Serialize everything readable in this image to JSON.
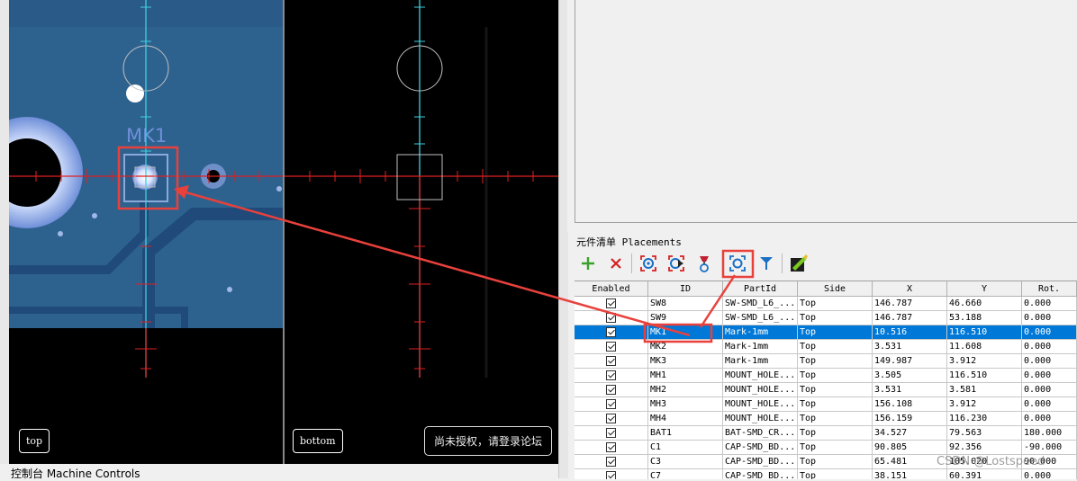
{
  "camera_views": {
    "top": {
      "label": "top",
      "overlay_text": "MK1"
    },
    "bottom": {
      "label": "bottom",
      "notice": "尚未授权，请登录论坛"
    }
  },
  "console": {
    "label": "控制台 Machine Controls"
  },
  "placements": {
    "title": "元件清单 Placements",
    "toolbar": [
      {
        "name": "add-icon",
        "tooltip": ""
      },
      {
        "name": "delete-icon",
        "tooltip": ""
      },
      {
        "name": "camera-target-icon",
        "tooltip": ""
      },
      {
        "name": "camera-move-icon",
        "tooltip": ""
      },
      {
        "name": "nozzle-icon",
        "tooltip": ""
      },
      {
        "name": "camera-position-icon",
        "tooltip": ""
      },
      {
        "name": "filter-icon",
        "tooltip": ""
      },
      {
        "name": "edit-icon",
        "tooltip": ""
      }
    ],
    "columns": [
      "Enabled",
      "ID",
      "PartId",
      "Side",
      "X",
      "Y",
      "Rot."
    ],
    "selected_row": 2,
    "rows": [
      {
        "enabled": true,
        "id": "SW8",
        "part": "SW-SMD_L6_...",
        "side": "Top",
        "x": "146.787",
        "y": "46.660",
        "rot": "0.000"
      },
      {
        "enabled": true,
        "id": "SW9",
        "part": "SW-SMD_L6_...",
        "side": "Top",
        "x": "146.787",
        "y": "53.188",
        "rot": "0.000"
      },
      {
        "enabled": true,
        "id": "MK1",
        "part": "Mark-1mm",
        "side": "Top",
        "x": "10.516",
        "y": "116.510",
        "rot": "0.000"
      },
      {
        "enabled": true,
        "id": "MK2",
        "part": "Mark-1mm",
        "side": "Top",
        "x": "3.531",
        "y": "11.608",
        "rot": "0.000"
      },
      {
        "enabled": true,
        "id": "MK3",
        "part": "Mark-1mm",
        "side": "Top",
        "x": "149.987",
        "y": "3.912",
        "rot": "0.000"
      },
      {
        "enabled": true,
        "id": "MH1",
        "part": "MOUNT_HOLE...",
        "side": "Top",
        "x": "3.505",
        "y": "116.510",
        "rot": "0.000"
      },
      {
        "enabled": true,
        "id": "MH2",
        "part": "MOUNT_HOLE...",
        "side": "Top",
        "x": "3.531",
        "y": "3.581",
        "rot": "0.000"
      },
      {
        "enabled": true,
        "id": "MH3",
        "part": "MOUNT_HOLE...",
        "side": "Top",
        "x": "156.108",
        "y": "3.912",
        "rot": "0.000"
      },
      {
        "enabled": true,
        "id": "MH4",
        "part": "MOUNT_HOLE...",
        "side": "Top",
        "x": "156.159",
        "y": "116.230",
        "rot": "0.000"
      },
      {
        "enabled": true,
        "id": "BAT1",
        "part": "BAT-SMD_CR...",
        "side": "Top",
        "x": "34.527",
        "y": "79.563",
        "rot": "180.000"
      },
      {
        "enabled": true,
        "id": "C1",
        "part": "CAP-SMD_BD...",
        "side": "Top",
        "x": "90.805",
        "y": "92.356",
        "rot": "-90.000"
      },
      {
        "enabled": true,
        "id": "C3",
        "part": "CAP-SMD_BD...",
        "side": "Top",
        "x": "65.481",
        "y": "105.020",
        "rot": "90.000"
      },
      {
        "enabled": true,
        "id": "C7",
        "part": "CAP-SMD_BD...",
        "side": "Top",
        "x": "38.151",
        "y": "60.391",
        "rot": "0.000"
      }
    ]
  },
  "watermark": "CSDN @Lostspeed",
  "colors": {
    "selection": "#0078d7",
    "annotation": "#e8413c",
    "crosshair_h": "#e02020",
    "crosshair_v": "#40d0e0",
    "pcb": "#2a5a88"
  }
}
